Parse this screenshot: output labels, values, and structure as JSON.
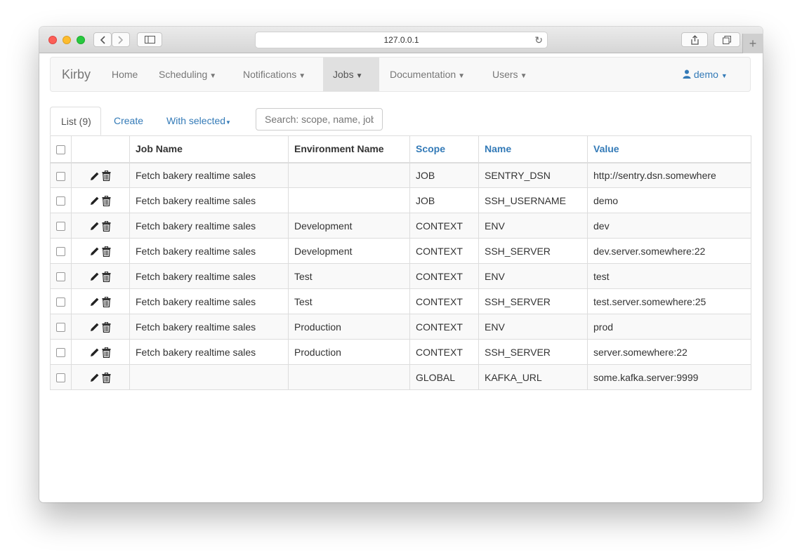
{
  "browser": {
    "url": "127.0.0.1"
  },
  "navbar": {
    "brand": "Kirby",
    "items": [
      {
        "label": "Home"
      },
      {
        "label": "Scheduling"
      },
      {
        "label": "Notifications"
      },
      {
        "label": "Jobs"
      },
      {
        "label": "Documentation"
      },
      {
        "label": "Users"
      }
    ],
    "user": "demo"
  },
  "tabs": {
    "list": "List (9)",
    "create": "Create",
    "with_selected": "With selected"
  },
  "search": {
    "placeholder": "Search: scope, name, job"
  },
  "table": {
    "headers": {
      "job_name": "Job Name",
      "environment_name": "Environment Name",
      "scope": "Scope",
      "name": "Name",
      "value": "Value"
    },
    "rows": [
      {
        "job": "Fetch bakery realtime sales",
        "env": "",
        "scope": "JOB",
        "name": "SENTRY_DSN",
        "value": "http://sentry.dsn.somewhere"
      },
      {
        "job": "Fetch bakery realtime sales",
        "env": "",
        "scope": "JOB",
        "name": "SSH_USERNAME",
        "value": "demo"
      },
      {
        "job": "Fetch bakery realtime sales",
        "env": "Development",
        "scope": "CONTEXT",
        "name": "ENV",
        "value": "dev"
      },
      {
        "job": "Fetch bakery realtime sales",
        "env": "Development",
        "scope": "CONTEXT",
        "name": "SSH_SERVER",
        "value": "dev.server.somewhere:22"
      },
      {
        "job": "Fetch bakery realtime sales",
        "env": "Test",
        "scope": "CONTEXT",
        "name": "ENV",
        "value": "test"
      },
      {
        "job": "Fetch bakery realtime sales",
        "env": "Test",
        "scope": "CONTEXT",
        "name": "SSH_SERVER",
        "value": "test.server.somewhere:25"
      },
      {
        "job": "Fetch bakery realtime sales",
        "env": "Production",
        "scope": "CONTEXT",
        "name": "ENV",
        "value": "prod"
      },
      {
        "job": "Fetch bakery realtime sales",
        "env": "Production",
        "scope": "CONTEXT",
        "name": "SSH_SERVER",
        "value": "server.somewhere:22"
      },
      {
        "job": "",
        "env": "",
        "scope": "GLOBAL",
        "name": "KAFKA_URL",
        "value": "some.kafka.server:9999"
      }
    ]
  },
  "colors": {
    "link": "#337ab7",
    "navbar_bg": "#f8f8f8",
    "active_nav_bg": "#e0e0e0"
  },
  "icons": [
    "back-icon",
    "forward-icon",
    "sidebar-icon",
    "reload-icon",
    "share-icon",
    "tabs-icon",
    "user-icon",
    "pencil-icon",
    "trash-icon"
  ]
}
